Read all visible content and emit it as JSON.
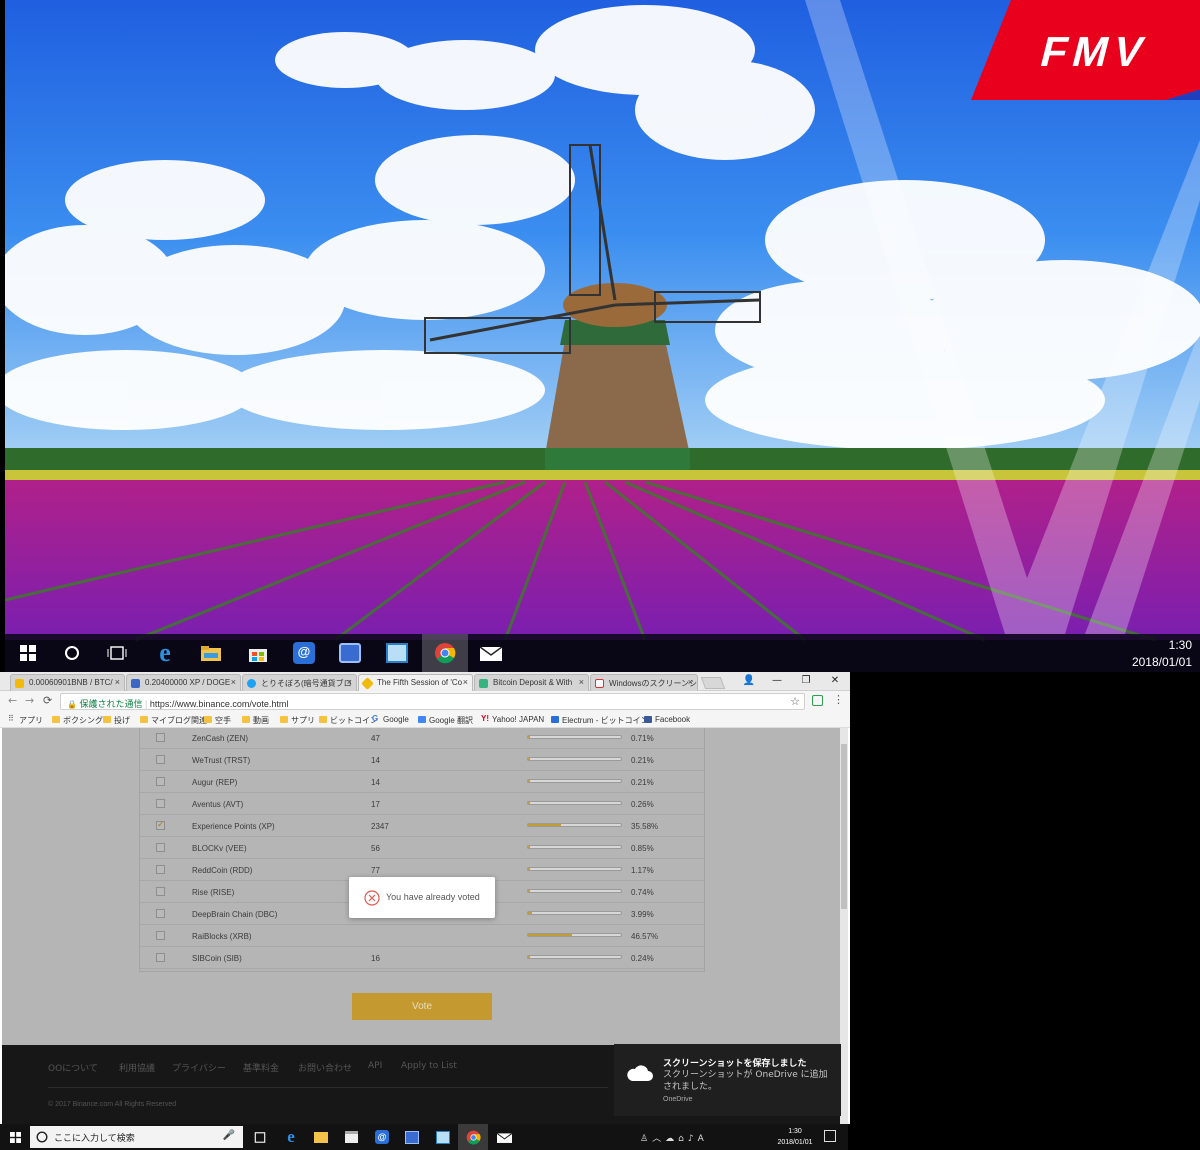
{
  "desktop": {
    "brand_logo": "FMV",
    "taskbar": {
      "icons": [
        "start-icon",
        "cortana-icon",
        "task-view-icon",
        "edge-icon",
        "file-explorer-icon",
        "store-icon",
        "at-menu-icon",
        "control-panel-icon",
        "window-app-icon",
        "chrome-icon",
        "mail-icon"
      ],
      "active_icon": "chrome-icon",
      "time": "1:30",
      "date": "2018/01/01"
    }
  },
  "browser": {
    "tabs": [
      {
        "title": "0.00060901BNB / BTC/",
        "active": false
      },
      {
        "title": "0.20400000 XP / DOGE",
        "active": false
      },
      {
        "title": "とりそぼろ(暗号通貨ブロ",
        "active": false
      },
      {
        "title": "The Fifth Session of 'Co",
        "active": true
      },
      {
        "title": "Bitcoin Deposit & With",
        "active": false
      },
      {
        "title": "Windowsのスクリーンショ",
        "active": false
      }
    ],
    "window_controls": {
      "profile": "👤",
      "minimize": "—",
      "restore": "❐",
      "close": "✕"
    },
    "nav": {
      "back": "←",
      "forward": "→",
      "reload": "⟳"
    },
    "address": {
      "secure_label": "保護された通信",
      "url": "https://www.binance.com/vote.html",
      "star": "☆"
    },
    "bookmarks": [
      {
        "label": "アプリ",
        "type": "apps"
      },
      {
        "label": "ボクシング",
        "type": "folder"
      },
      {
        "label": "投げ",
        "type": "folder"
      },
      {
        "label": "マイブログ関連",
        "type": "folder"
      },
      {
        "label": "空手",
        "type": "folder"
      },
      {
        "label": "動画",
        "type": "folder"
      },
      {
        "label": "サプリ",
        "type": "folder"
      },
      {
        "label": "ビットコイン",
        "type": "folder"
      },
      {
        "label": "Google",
        "type": "google"
      },
      {
        "label": "Google 翻訳",
        "type": "translate"
      },
      {
        "label": "Yahoo! JAPAN",
        "type": "yahoo"
      },
      {
        "label": "Electrum - ビットコイン",
        "type": "electrum"
      },
      {
        "label": "Facebook",
        "type": "facebook"
      }
    ]
  },
  "vote": {
    "rows": [
      {
        "name": "ZenCash (ZEN)",
        "votes": "47",
        "percent": "0.71%",
        "ratio": 0.0071,
        "checked": false
      },
      {
        "name": "WeTrust (TRST)",
        "votes": "14",
        "percent": "0.21%",
        "ratio": 0.0021,
        "checked": false
      },
      {
        "name": "Augur (REP)",
        "votes": "14",
        "percent": "0.21%",
        "ratio": 0.0021,
        "checked": false
      },
      {
        "name": "Aventus (AVT)",
        "votes": "17",
        "percent": "0.26%",
        "ratio": 0.0026,
        "checked": false
      },
      {
        "name": "Experience Points (XP)",
        "votes": "2347",
        "percent": "35.58%",
        "ratio": 0.3558,
        "checked": true
      },
      {
        "name": "BLOCKv (VEE)",
        "votes": "56",
        "percent": "0.85%",
        "ratio": 0.0085,
        "checked": false
      },
      {
        "name": "ReddCoin (RDD)",
        "votes": "77",
        "percent": "1.17%",
        "ratio": 0.0117,
        "checked": false
      },
      {
        "name": "Rise (RISE)",
        "votes": "49",
        "percent": "0.74%",
        "ratio": 0.0074,
        "checked": false
      },
      {
        "name": "DeepBrain Chain (DBC)",
        "votes": "",
        "percent": "3.99%",
        "ratio": 0.0399,
        "checked": false
      },
      {
        "name": "RaiBlocks (XRB)",
        "votes": "",
        "percent": "46.57%",
        "ratio": 0.4657,
        "checked": false
      },
      {
        "name": "SIBCoin (SIB)",
        "votes": "16",
        "percent": "0.24%",
        "ratio": 0.0024,
        "checked": false
      }
    ],
    "toast_message": "You have already voted",
    "vote_button": "Vote",
    "accent_color": "#c49a30"
  },
  "footer": {
    "links": [
      "OOについて",
      "利用協議",
      "プライバシー",
      "基準料金",
      "お問い合わせ",
      "API",
      "Apply to List"
    ],
    "copyright": "© 2017 Binance.com All Rights Reserved"
  },
  "notification": {
    "title": "スクリーンショットを保存しました",
    "body": "スクリーンショットが OneDrive に追加されました。",
    "source": "OneDrive"
  },
  "taskbar2": {
    "search_placeholder": "ここに入力して検索",
    "time": "1:30",
    "date": "2018/01/01",
    "tray_icons": [
      "people-icon",
      "chevron-up-icon",
      "onedrive-icon",
      "network-icon",
      "volume-icon",
      "ime-icon",
      "action-center-icon"
    ]
  }
}
